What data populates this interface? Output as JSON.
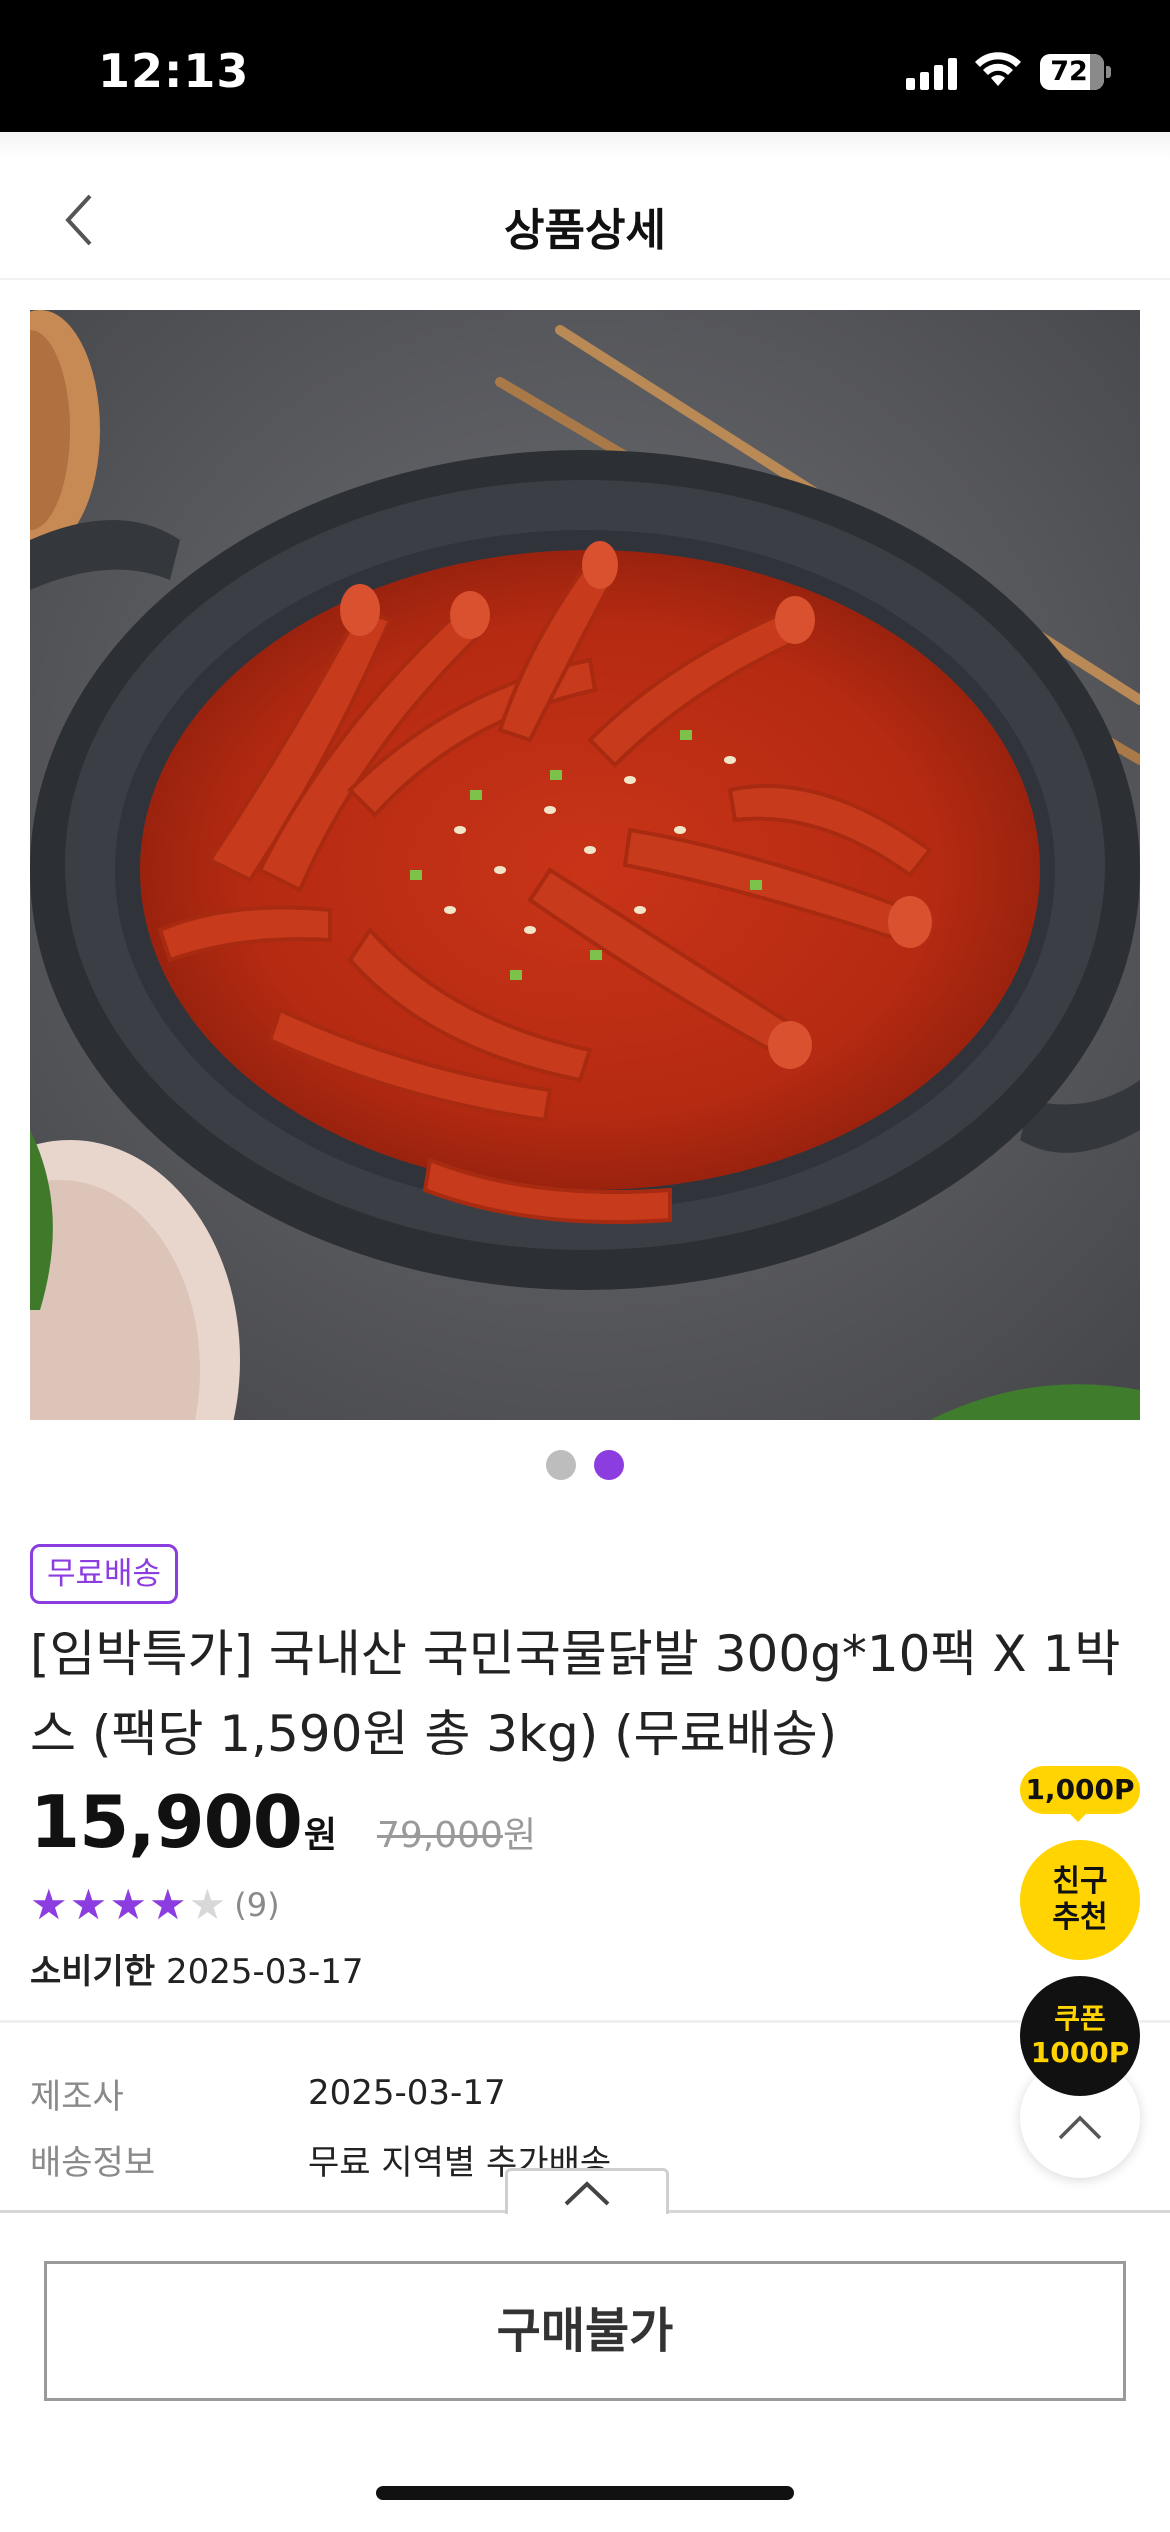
{
  "status_bar": {
    "time": "12:13",
    "battery": "72"
  },
  "header": {
    "title": "상품상세"
  },
  "gallery": {
    "total": 2,
    "active_index": 2
  },
  "product": {
    "badge": "무료배송",
    "title": "[임박특가] 국내산 국민국물닭발 300g*10팩 X 1박스 (팩당 1,590원 총 3kg) (무료배송)",
    "price": "15,900",
    "price_unit": "원",
    "original_price": "79,000",
    "original_unit": "원",
    "rating": 4,
    "rating_max": 5,
    "review_count": "(9)",
    "expiry_label": "소비기한",
    "expiry_date": "2025-03-17"
  },
  "info": {
    "rows": [
      {
        "label": "제조사",
        "value": "2025-03-17"
      },
      {
        "label": "배송정보",
        "value": "무료 지역별 추가배송"
      }
    ]
  },
  "floating": {
    "point_badge": "1,000P",
    "friend_line1": "친구",
    "friend_line2": "추천",
    "coupon_line1": "쿠폰",
    "coupon_line2": "1000P"
  },
  "bottom": {
    "buy_label": "구매불가"
  },
  "colors": {
    "accent": "#8c3de0",
    "yellow": "#ffd400"
  }
}
